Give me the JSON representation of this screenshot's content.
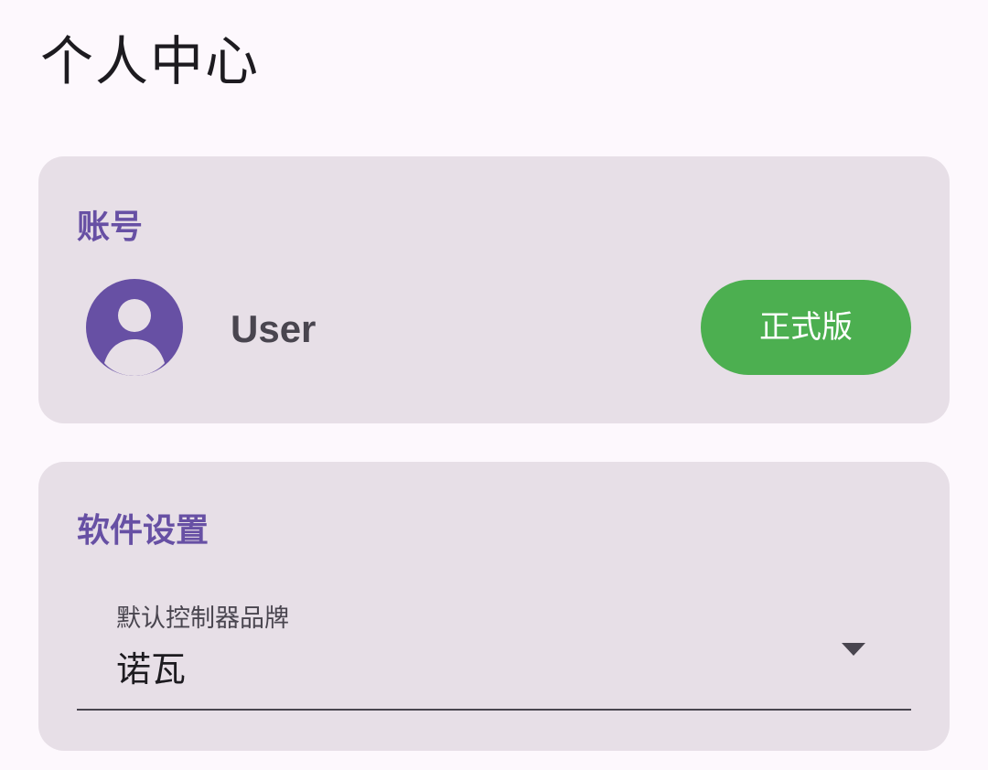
{
  "header": {
    "title": "个人中心"
  },
  "account": {
    "section_title": "账号",
    "avatar_icon": "account-circle-icon",
    "username": "User",
    "edition_label": "正式版"
  },
  "settings": {
    "section_title": "软件设置",
    "controller_brand": {
      "label": "默认控制器品牌",
      "selected_value": "诺瓦",
      "arrow_icon": "dropdown-arrow-icon"
    }
  },
  "colors": {
    "background": "#fdf8fd",
    "card": "#e7dfe7",
    "accent": "#6750a4",
    "edition_button": "#4caf50",
    "text_primary": "#1d1b20",
    "text_secondary": "#49454f"
  }
}
